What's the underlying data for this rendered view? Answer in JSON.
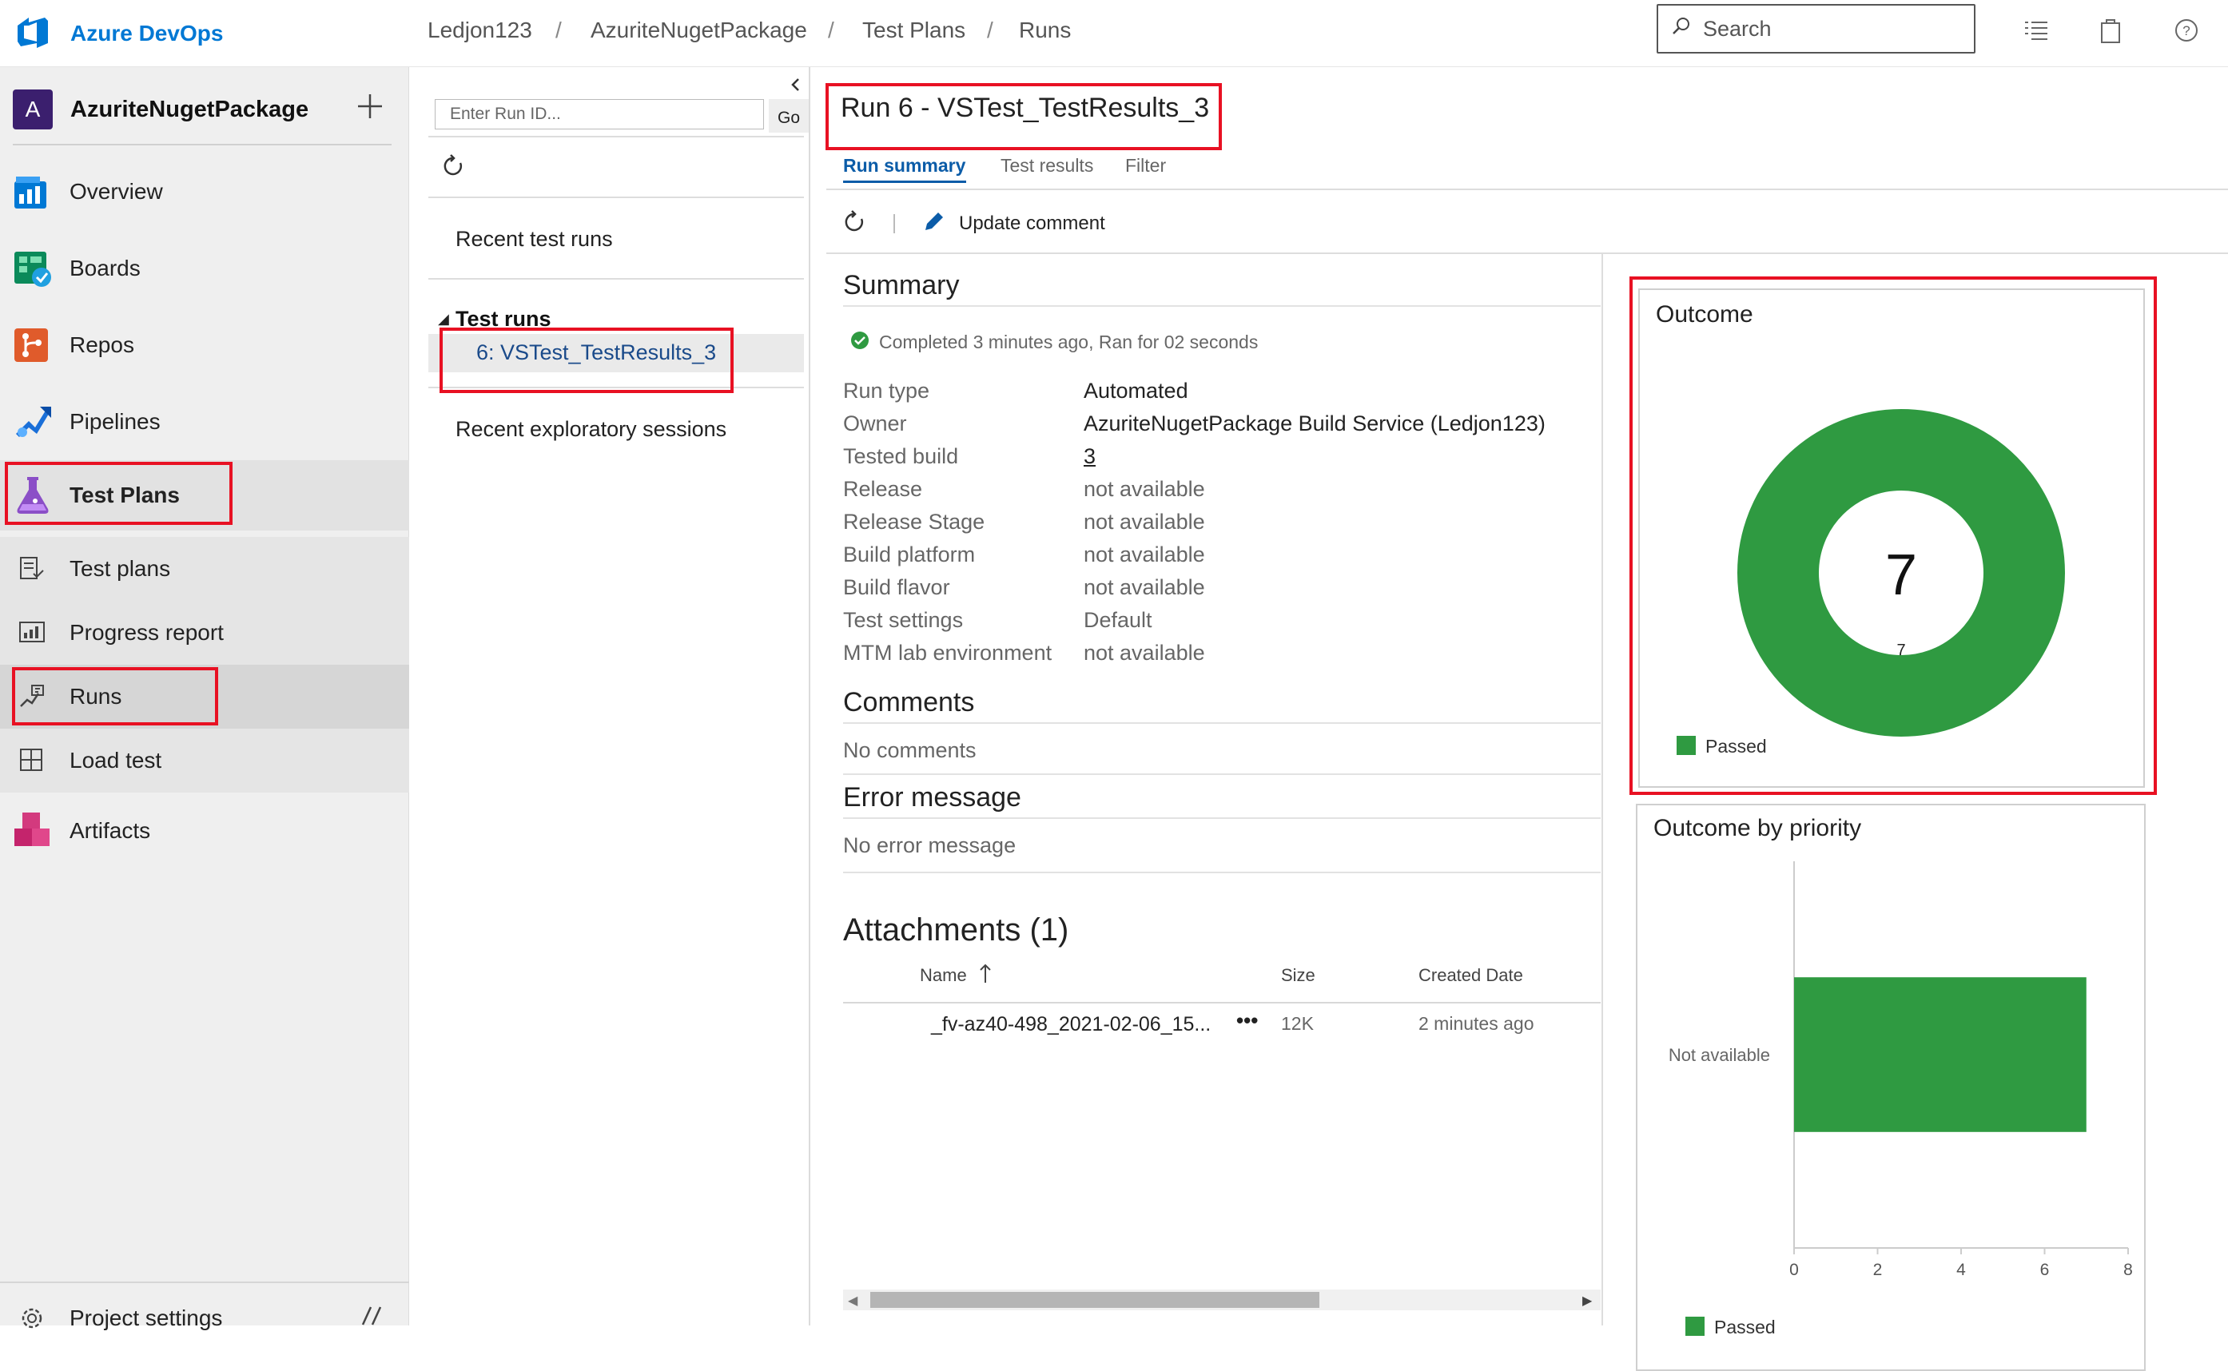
{
  "app": {
    "name": "Azure DevOps"
  },
  "breadcrumb": [
    "Ledjon123",
    "AzuriteNugetPackage",
    "Test Plans",
    "Runs"
  ],
  "search": {
    "placeholder": "Search"
  },
  "project": {
    "initial": "A",
    "name": "AzuriteNugetPackage"
  },
  "nav": {
    "overview": "Overview",
    "boards": "Boards",
    "repos": "Repos",
    "pipelines": "Pipelines",
    "test_plans": "Test Plans",
    "sub": {
      "test_plans": "Test plans",
      "progress_report": "Progress report",
      "runs": "Runs",
      "load_test": "Load test"
    },
    "artifacts": "Artifacts",
    "project_settings": "Project settings"
  },
  "runs_panel": {
    "run_id_placeholder": "Enter Run ID...",
    "go_label": "Go",
    "recent_runs": "Recent test runs",
    "test_runs_header": "Test runs",
    "selected_run": "6: VSTest_TestResults_3",
    "exploratory": "Recent exploratory sessions"
  },
  "run": {
    "title": "Run 6 - VSTest_TestResults_3",
    "tabs": [
      "Run summary",
      "Test results",
      "Filter"
    ],
    "update_comment": "Update comment",
    "summary_title": "Summary",
    "status": "Completed 3 minutes ago, Ran for 02 seconds",
    "fields": [
      {
        "label": "Run type",
        "value": "Automated"
      },
      {
        "label": "Owner",
        "value": "AzuriteNugetPackage Build Service (Ledjon123)"
      },
      {
        "label": "Tested build",
        "value": "3"
      },
      {
        "label": "Release",
        "value": "not available"
      },
      {
        "label": "Release Stage",
        "value": "not available"
      },
      {
        "label": "Build platform",
        "value": "not available"
      },
      {
        "label": "Build flavor",
        "value": "not available"
      },
      {
        "label": "Test settings",
        "value": "Default"
      },
      {
        "label": "MTM lab environment",
        "value": "not available"
      }
    ],
    "comments_title": "Comments",
    "comments_text": "No comments",
    "error_title": "Error message",
    "error_text": "No error message",
    "attachments_title": "Attachments (1)",
    "attachment_headers": {
      "name": "Name",
      "size": "Size",
      "created": "Created Date"
    },
    "attachment": {
      "name": "_fv-az40-498_2021-02-06_15...",
      "size": "12K",
      "created": "2 minutes ago"
    }
  },
  "outcome": {
    "title": "Outcome",
    "total": "7",
    "slice_label": "7",
    "legend": "Passed",
    "color": "#2f9a41"
  },
  "priority": {
    "title": "Outcome by priority",
    "legend": "Passed"
  },
  "chart_data": {
    "type": "bar",
    "title": "Outcome by priority",
    "categories": [
      "Not available"
    ],
    "series": [
      {
        "name": "Passed",
        "values": [
          7
        ]
      }
    ],
    "x_ticks": [
      "0",
      "2",
      "4",
      "6",
      "8"
    ],
    "xlim": [
      0,
      8
    ],
    "color": "#2f9a41"
  }
}
